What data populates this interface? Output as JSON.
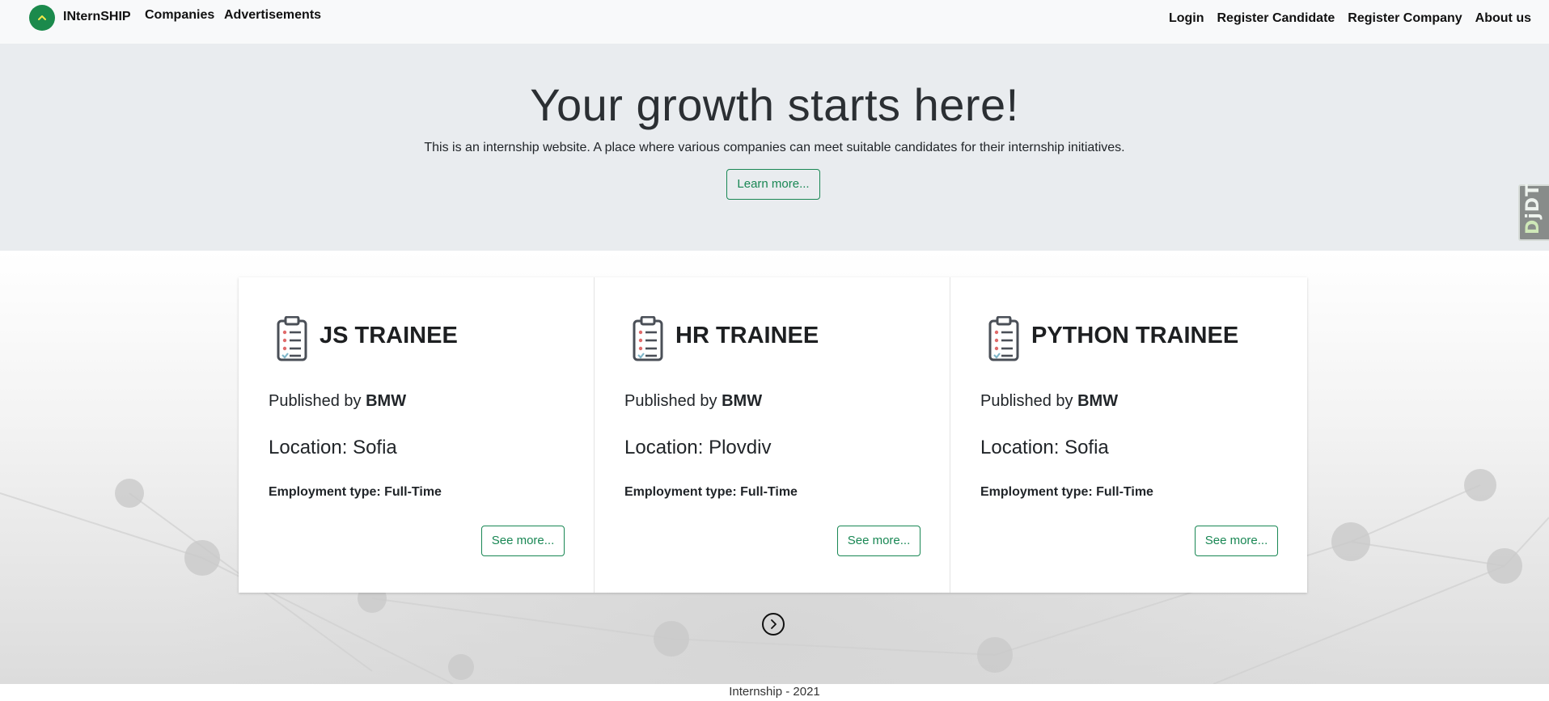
{
  "navbar": {
    "brand": "INternSHIP",
    "left_links": [
      "Companies",
      "Advertisements"
    ],
    "right_links": [
      "Login",
      "Register Candidate",
      "Register Company",
      "About us"
    ]
  },
  "hero": {
    "title": "Your growth starts here!",
    "lead": "This is an internship website. A place where various companies can meet suitable candidates for their internship initiatives.",
    "button": "Learn more..."
  },
  "djdt": {
    "label_d": "D",
    "label_rest": "jDT"
  },
  "cards": [
    {
      "title": "JS TRAINEE",
      "published_prefix": "Published by",
      "company": "BMW",
      "location": "Location: Sofia",
      "employment": "Employment type: Full-Time",
      "button": "See more..."
    },
    {
      "title": "HR TRAINEE",
      "published_prefix": "Published by",
      "company": "BMW",
      "location": "Location: Plovdiv",
      "employment": "Employment type: Full-Time",
      "button": "See more..."
    },
    {
      "title": "PYTHON TRAINEE",
      "published_prefix": "Published by",
      "company": "BMW",
      "location": "Location: Sofia",
      "employment": "Employment type: Full-Time",
      "button": "See more..."
    }
  ],
  "icons": {
    "logo": "chevron-up-icon",
    "card": "clipboard-checklist-icon",
    "next": "chevron-right-circle-icon"
  },
  "colors": {
    "accent": "#198754",
    "logo_bg": "#1b8a4c",
    "hero_bg": "#e9ecef",
    "navbar_bg": "#f8f9fa"
  },
  "footer": {
    "text": "Internship - 2021"
  }
}
